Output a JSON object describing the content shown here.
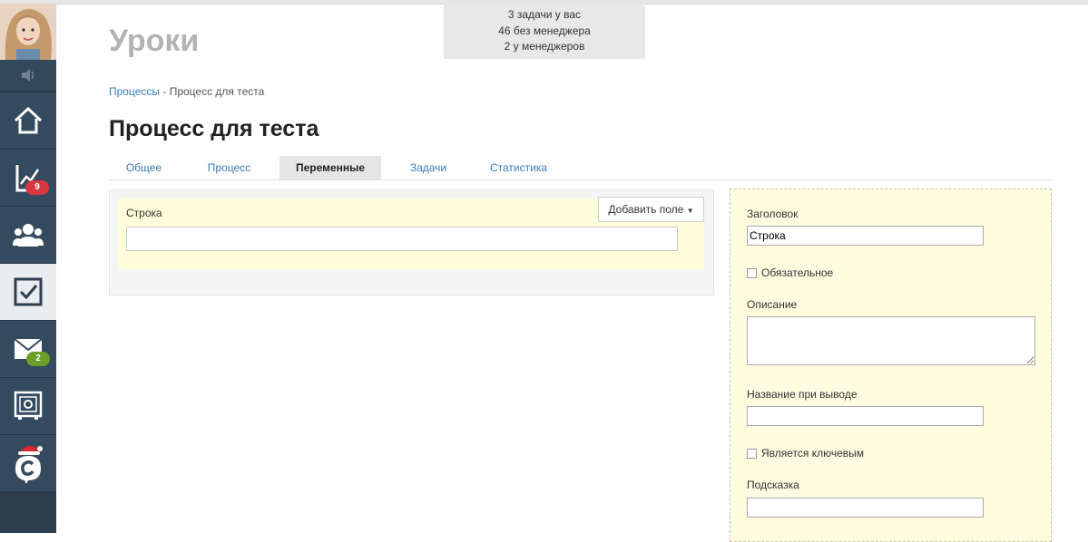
{
  "stats": {
    "line1": "3 задачи у вас",
    "line2": "46 без менеджера",
    "line3": "2 у менеджеров"
  },
  "page_heading": "Уроки",
  "breadcrumb": {
    "link": "Процессы",
    "separator": "-",
    "current": "Процесс для теста"
  },
  "title": "Процесс для теста",
  "tabs": [
    {
      "label": "Общее"
    },
    {
      "label": "Процесс"
    },
    {
      "label": "Переменные",
      "active": true
    },
    {
      "label": "Задачи"
    },
    {
      "label": "Статистика"
    }
  ],
  "sidebar": {
    "items": [
      {
        "icon": "home-icon"
      },
      {
        "icon": "chart-icon",
        "badge": "9"
      },
      {
        "icon": "users-icon"
      },
      {
        "icon": "checkbox-icon",
        "active": true
      },
      {
        "icon": "mail-icon",
        "badge": "2"
      },
      {
        "icon": "safe-icon"
      },
      {
        "icon": "logo-icon"
      }
    ]
  },
  "variables": {
    "field_label": "Строка",
    "field_value": "",
    "add_button": "Добавить поле"
  },
  "editor": {
    "header_label": "Заголовок",
    "header_value": "Строка",
    "required_label": "Обязательное",
    "description_label": "Описание",
    "display_name_label": "Название при выводе",
    "key_label": "Является ключевым",
    "hint_label": "Подсказка"
  },
  "colors": {
    "sidebar": "#2d3e4f",
    "link": "#3a7ab5",
    "highlight": "#fefdd9",
    "badge_red": "#d9363e",
    "badge_green": "#6b9f2a"
  }
}
